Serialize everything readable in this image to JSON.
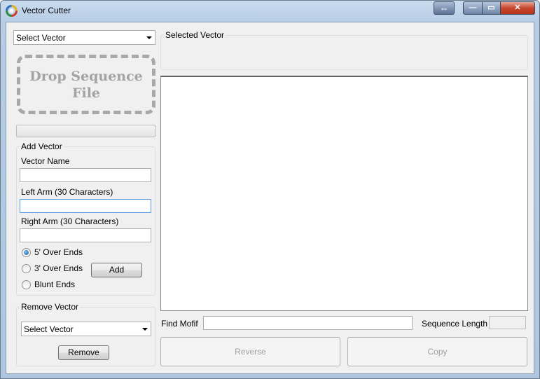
{
  "window": {
    "title": "Vector Cutter",
    "icon": "vector-cutter-app-icon",
    "controls": {
      "resize": "⇔",
      "minimize": "—",
      "maximize": "▭",
      "close": "✕"
    }
  },
  "left": {
    "select_vector": "Select Vector",
    "drop_zone_line1": "Drop Sequence",
    "drop_zone_line2": "File",
    "add_vector": {
      "legend": "Add Vector",
      "vector_name_label": "Vector Name",
      "vector_name_value": "",
      "left_arm_label": "Left Arm (30 Characters)",
      "left_arm_value": "",
      "right_arm_label": "Right Arm (30 Characters)",
      "right_arm_value": "",
      "radios": [
        {
          "label": "5' Over Ends",
          "checked": true
        },
        {
          "label": "3' Over Ends",
          "checked": false
        },
        {
          "label": "Blunt Ends",
          "checked": false
        }
      ],
      "add_button": "Add"
    },
    "remove_vector": {
      "legend": "Remove Vector",
      "select_value": "Select Vector",
      "remove_button": "Remove"
    }
  },
  "right": {
    "selected_vector_legend": "Selected Vector",
    "find_motif_label": "Find Mofif",
    "find_motif_value": "",
    "sequence_length_label": "Sequence Length",
    "sequence_length_value": "",
    "reverse_button": "Reverse",
    "copy_button": "Copy"
  },
  "colors": {
    "title_bar": "#b7cde6",
    "client_bg": "#f0f0f0",
    "close_button": "#c6472d"
  }
}
